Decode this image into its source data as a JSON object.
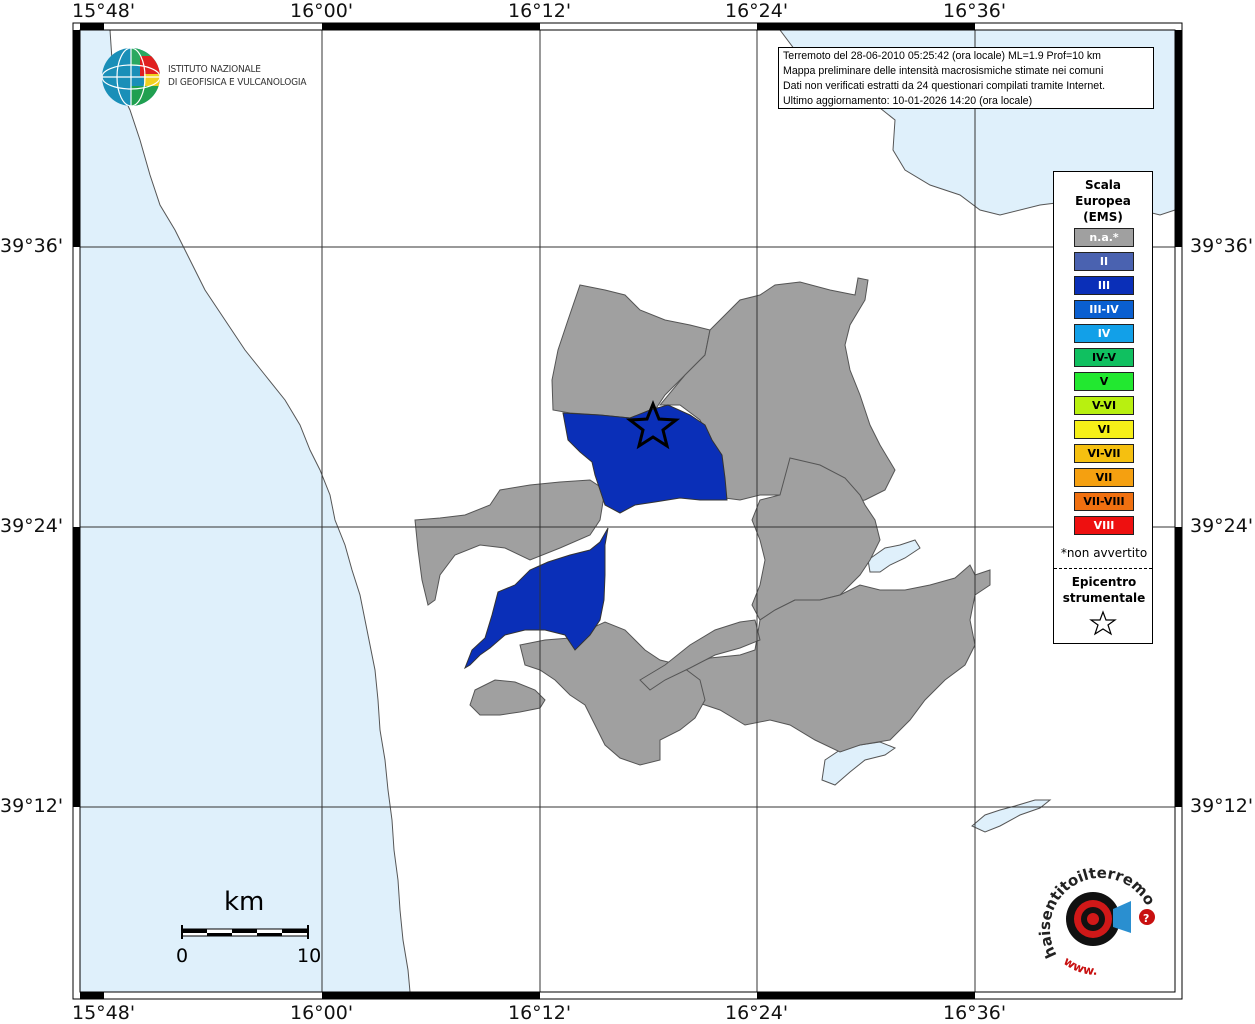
{
  "map": {
    "longitude_labels": [
      "15°48'",
      "16°00'",
      "16°12'",
      "16°24'",
      "16°36'"
    ],
    "latitude_labels": [
      "39°36'",
      "39°24'",
      "39°12'"
    ]
  },
  "info": {
    "line1": "Terremoto del 28-06-2010 05:25:42 (ora locale) ML=1.9 Prof=10 km",
    "line2": "Mappa preliminare delle intensità macrosismiche stimate nei comuni",
    "line3": "Dati non verificati estratti da 24 questionari compilati tramite Internet.",
    "line4": "Ultimo aggiornamento: 10-01-2026 14:20 (ora locale)"
  },
  "legend": {
    "title1": "Scala",
    "title2": "Europea",
    "title3": "(EMS)",
    "items": [
      {
        "label": "n.a.*",
        "color": "#a0a0a0"
      },
      {
        "label": "II",
        "color": "#4a62b0"
      },
      {
        "label": "III",
        "color": "#0a2fb8"
      },
      {
        "label": "III-IV",
        "color": "#0a5fd0"
      },
      {
        "label": "IV",
        "color": "#12a0e8"
      },
      {
        "label": "IV-V",
        "color": "#10c060"
      },
      {
        "label": "V",
        "color": "#22e830"
      },
      {
        "label": "V-VI",
        "color": "#b8f010"
      },
      {
        "label": "VI",
        "color": "#f6f018"
      },
      {
        "label": "VI-VII",
        "color": "#f5c010"
      },
      {
        "label": "VII",
        "color": "#f5a010"
      },
      {
        "label": "VII-VIII",
        "color": "#f07010"
      },
      {
        "label": "VIII",
        "color": "#ee1010"
      }
    ],
    "note": "*non avvertito",
    "epicentre1": "Epicentro",
    "epicentre2": "strumentale"
  },
  "logo": {
    "line1": "ISTITUTO NAZIONALE",
    "line2": "DI GEOFISICA E VULCANOLOGIA"
  },
  "scale": {
    "unit": "km",
    "min": "0",
    "max": "10"
  },
  "site_logo": {
    "text": "haisentitoilterremoto.it",
    "www": "www."
  },
  "colors": {
    "sea": "#dff0fb",
    "not_felt": "#a0a0a0",
    "intensity_III": "#0a2fb8"
  }
}
